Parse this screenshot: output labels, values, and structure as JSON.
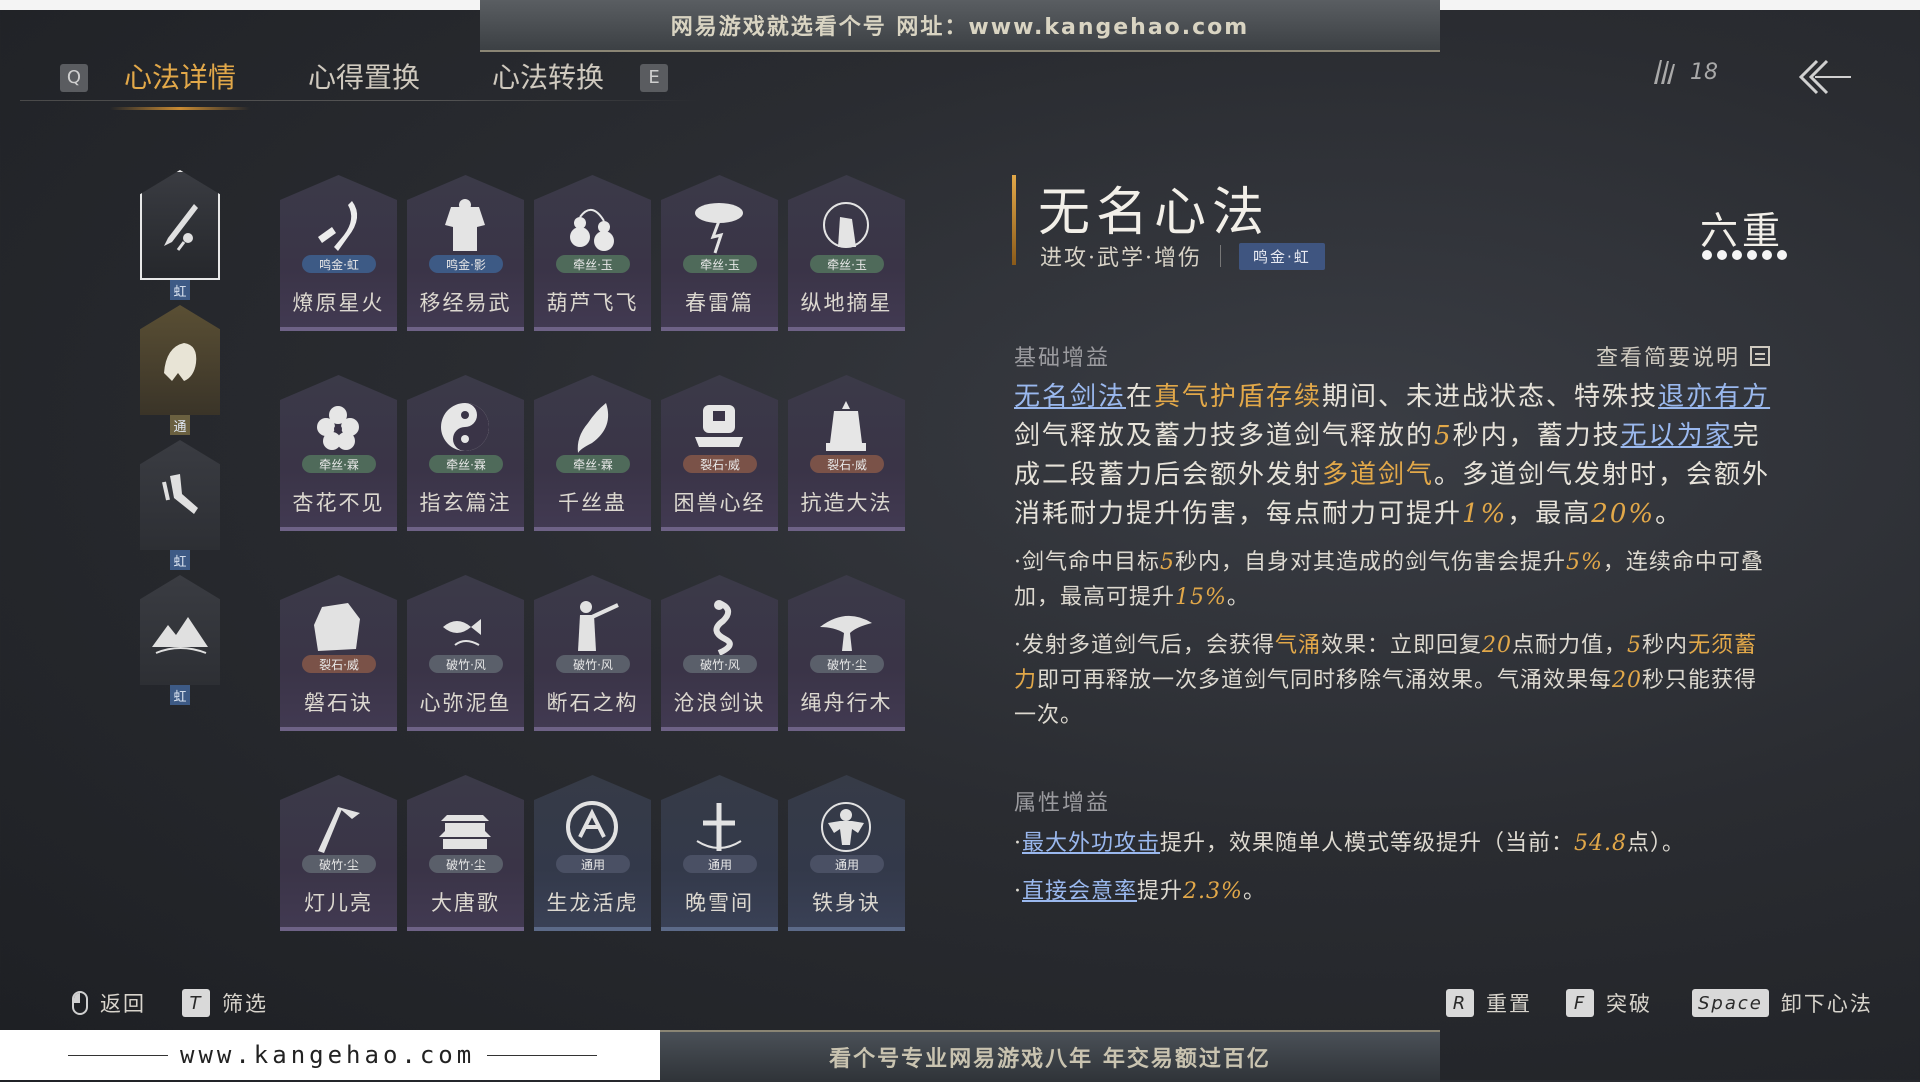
{
  "watermark": {
    "top_text": "网易游戏就选看个号  网址：www.kangehao.com",
    "bottom_text": "看个号专业网易游戏八年  年交易额过百亿",
    "bottom_left_url": "www.kangehao.com"
  },
  "tabs": {
    "left_key": "Q",
    "right_key": "E",
    "items": [
      {
        "label": "心法详情",
        "active": true
      },
      {
        "label": "心得置换",
        "active": false
      },
      {
        "label": "心法转换",
        "active": false
      }
    ]
  },
  "header": {
    "currency_count": "18"
  },
  "slots": [
    {
      "badge": "虹",
      "selected": true,
      "icon": "sword-icon"
    },
    {
      "badge": "通",
      "selected": false,
      "icon": "beast-icon"
    },
    {
      "badge": "虹",
      "selected": false,
      "icon": "hand-icon"
    },
    {
      "badge": "虹",
      "selected": false,
      "icon": "mountain-icon"
    }
  ],
  "cards": [
    {
      "name": "燎原星火",
      "tag": "鸣金·虹",
      "tag_color": "#3d5a85",
      "icon": "scythe-icon"
    },
    {
      "name": "移经易武",
      "tag": "鸣金·影",
      "tag_color": "#3d5a85",
      "icon": "armor-icon"
    },
    {
      "name": "葫芦飞飞",
      "tag": "牵丝·玉",
      "tag_color": "#4f6a5a",
      "icon": "gourd-icon"
    },
    {
      "name": "春雷篇",
      "tag": "牵丝·玉",
      "tag_color": "#4f6a5a",
      "icon": "thunder-tree-icon"
    },
    {
      "name": "纵地摘星",
      "tag": "牵丝·玉",
      "tag_color": "#4f6a5a",
      "icon": "star-figure-icon"
    },
    {
      "name": "杏花不见",
      "tag": "牵丝·霖",
      "tag_color": "#4f6a5a",
      "icon": "flower-icon"
    },
    {
      "name": "指玄篇注",
      "tag": "牵丝·霖",
      "tag_color": "#4f6a5a",
      "icon": "yinyang-icon"
    },
    {
      "name": "千丝蛊",
      "tag": "牵丝·霖",
      "tag_color": "#4f6a5a",
      "icon": "leaf-icon"
    },
    {
      "name": "困兽心经",
      "tag": "裂石·威",
      "tag_color": "#7a5248",
      "icon": "beast-trap-icon"
    },
    {
      "name": "抗造大法",
      "tag": "裂石·威",
      "tag_color": "#7a5248",
      "icon": "bell-icon"
    },
    {
      "name": "磐石诀",
      "tag": "裂石·威",
      "tag_color": "#7a5248",
      "icon": "rock-icon"
    },
    {
      "name": "心弥泥鱼",
      "tag": "破竹·风",
      "tag_color": "#5a5f6a",
      "icon": "fish-icon"
    },
    {
      "name": "断石之构",
      "tag": "破竹·风",
      "tag_color": "#5a5f6a",
      "icon": "warrior-icon"
    },
    {
      "name": "沧浪剑诀",
      "tag": "破竹·风",
      "tag_color": "#5a5f6a",
      "icon": "dragon-icon"
    },
    {
      "name": "绳舟行木",
      "tag": "破竹·尘",
      "tag_color": "#5a5f6a",
      "icon": "tree-icon"
    },
    {
      "name": "灯儿亮",
      "tag": "破竹·尘",
      "tag_color": "#5a5f6a",
      "icon": "lantern-icon"
    },
    {
      "name": "大唐歌",
      "tag": "破竹·尘",
      "tag_color": "#5a5f6a",
      "icon": "palace-icon"
    },
    {
      "name": "生龙活虎",
      "tag": "通用",
      "tag_color": "#4a5064",
      "icon": "tiger-seal-icon",
      "generic": true
    },
    {
      "name": "晚雪间",
      "tag": "通用",
      "tag_color": "#4a5064",
      "icon": "cross-blade-icon",
      "generic": true
    },
    {
      "name": "铁身诀",
      "tag": "通用",
      "tag_color": "#4a5064",
      "icon": "muscle-icon",
      "generic": true
    }
  ],
  "detail": {
    "title": "无名心法",
    "subtitle": "进攻·武学·增伤",
    "rank_tag": "鸣金·虹",
    "level": "六重",
    "level_dots": 6,
    "base_heading": "基础增益",
    "summary_link": "查看简要说明",
    "main_parts": [
      {
        "t": "无名剑法",
        "s": "lk"
      },
      {
        "t": "在",
        "s": ""
      },
      {
        "t": "真气护盾存续",
        "s": "hl"
      },
      {
        "t": "期间、未进战状态、特殊技",
        "s": ""
      },
      {
        "t": "退亦有方",
        "s": "lk"
      },
      {
        "t": "剑气释放及蓄力技多道剑气释放的",
        "s": ""
      },
      {
        "t": "5",
        "s": "num"
      },
      {
        "t": "秒内，蓄力技",
        "s": ""
      },
      {
        "t": "无以为家",
        "s": "lk"
      },
      {
        "t": "完成二段蓄力后会额外发射",
        "s": ""
      },
      {
        "t": "多道剑气",
        "s": "hl"
      },
      {
        "t": "。多道剑气发射时，会额外消耗耐力提升伤害，每点耐力可提升",
        "s": ""
      },
      {
        "t": "1%",
        "s": "num"
      },
      {
        "t": "，最高",
        "s": ""
      },
      {
        "t": "20%",
        "s": "num"
      },
      {
        "t": "。",
        "s": ""
      }
    ],
    "sub1_parts": [
      {
        "t": "·剑气命中目标",
        "s": ""
      },
      {
        "t": "5",
        "s": "num"
      },
      {
        "t": "秒内，自身对其造成的剑气伤害会提升",
        "s": ""
      },
      {
        "t": "5%",
        "s": "num"
      },
      {
        "t": "，连续命中可叠加，最高可提升",
        "s": ""
      },
      {
        "t": "15%",
        "s": "num"
      },
      {
        "t": "。",
        "s": ""
      }
    ],
    "sub2_parts": [
      {
        "t": "·发射多道剑气后，会获得",
        "s": ""
      },
      {
        "t": "气涌",
        "s": "hl"
      },
      {
        "t": "效果：立即回复",
        "s": ""
      },
      {
        "t": "20",
        "s": "num"
      },
      {
        "t": "点耐力值，",
        "s": ""
      },
      {
        "t": "5",
        "s": "num"
      },
      {
        "t": "秒内",
        "s": ""
      },
      {
        "t": "无须蓄力",
        "s": "hl"
      },
      {
        "t": "即可再释放一次多道剑气同时移除气涌效果。气涌效果每",
        "s": ""
      },
      {
        "t": "20",
        "s": "num"
      },
      {
        "t": "秒只能获得一次。",
        "s": ""
      }
    ],
    "attr_heading": "属性增益",
    "attr1_parts": [
      {
        "t": "·",
        "s": ""
      },
      {
        "t": "最大外功攻击",
        "s": "lk"
      },
      {
        "t": "提升，效果随单人模式等级提升（当前：",
        "s": ""
      },
      {
        "t": "54.8",
        "s": "num"
      },
      {
        "t": "点）。",
        "s": ""
      }
    ],
    "attr2_parts": [
      {
        "t": "·",
        "s": ""
      },
      {
        "t": "直接会意率",
        "s": "lk"
      },
      {
        "t": "提升",
        "s": ""
      },
      {
        "t": "2.3%",
        "s": "num"
      },
      {
        "t": "。",
        "s": ""
      }
    ]
  },
  "footer": {
    "back_label": "返回",
    "filter_key": "T",
    "filter_label": "筛选",
    "reset_key": "R",
    "reset_label": "重置",
    "break_key": "F",
    "break_label": "突破",
    "unequip_key": "Space",
    "unequip_label": "卸下心法"
  }
}
